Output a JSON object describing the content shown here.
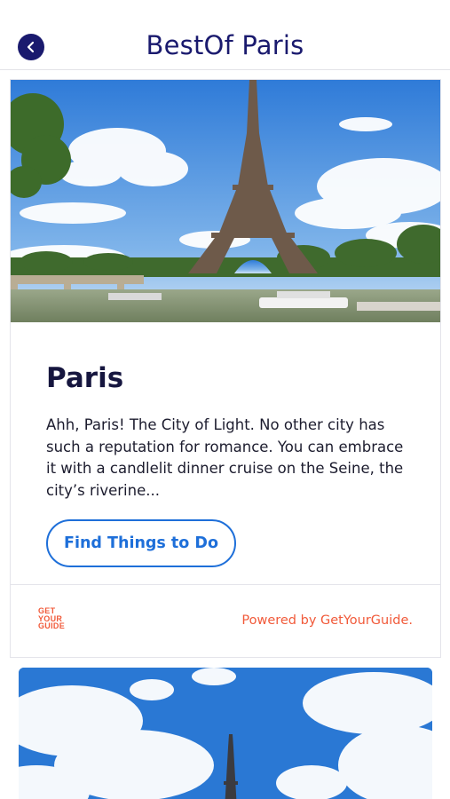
{
  "header": {
    "title": "BestOf Paris",
    "back_icon": "chevron-left-icon"
  },
  "card": {
    "image_subject": "eiffel-tower-seine",
    "title": "Paris",
    "description": "Ahh, Paris! The City of Light. No other city has such a reputation for romance. You can embrace it with a candlelit dinner cruise on the Seine, the city’s riverine...",
    "button_label": "Find Things to Do",
    "logo_lines": [
      "GET",
      "YOUR",
      "GUIDE"
    ],
    "powered_by": "Powered by GetYourGuide."
  },
  "next_card": {
    "image_subject": "eiffel-tower-sky"
  },
  "colors": {
    "brand_navy": "#1a1a6e",
    "accent_blue": "#1e6fd9",
    "gyg_orange": "#f15a3a"
  }
}
